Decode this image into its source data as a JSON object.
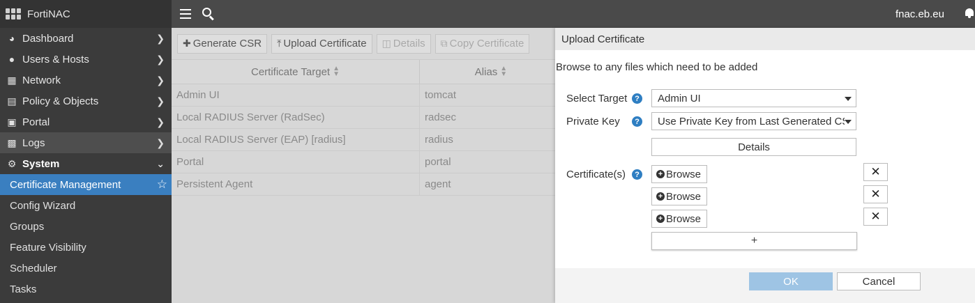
{
  "app": {
    "name": "FortiNAC",
    "host": "fnac.eb.eu"
  },
  "sidebar": {
    "items": [
      {
        "label": "Dashboard",
        "icon": "dashboard-icon"
      },
      {
        "label": "Users & Hosts",
        "icon": "user-icon"
      },
      {
        "label": "Network",
        "icon": "network-icon"
      },
      {
        "label": "Policy & Objects",
        "icon": "policy-icon"
      },
      {
        "label": "Portal",
        "icon": "portal-icon"
      },
      {
        "label": "Logs",
        "icon": "chart-icon"
      },
      {
        "label": "System",
        "icon": "gear-icon"
      }
    ],
    "subitems": [
      {
        "label": "Certificate Management",
        "active": true
      },
      {
        "label": "Config Wizard"
      },
      {
        "label": "Groups"
      },
      {
        "label": "Feature Visibility"
      },
      {
        "label": "Scheduler"
      },
      {
        "label": "Tasks"
      }
    ]
  },
  "toolbar": {
    "generate_csr": "Generate CSR",
    "upload_certificate": "Upload Certificate",
    "details": "Details",
    "copy_certificate": "Copy Certificate"
  },
  "table": {
    "columns": [
      "Certificate Target",
      "Alias"
    ],
    "rows": [
      [
        "Admin UI",
        "tomcat"
      ],
      [
        "Local RADIUS Server (RadSec)",
        "radsec"
      ],
      [
        "Local RADIUS Server (EAP) [radius]",
        "radius"
      ],
      [
        "Portal",
        "portal"
      ],
      [
        "Persistent Agent",
        "agent"
      ]
    ]
  },
  "dialog": {
    "title": "Upload Certificate",
    "message": "Browse to any files which need to be added",
    "select_target_label": "Select Target",
    "select_target_value": "Admin UI",
    "private_key_label": "Private Key",
    "private_key_value": "Use Private Key from Last Generated CSR",
    "details_label": "Details",
    "certificates_label": "Certificate(s)",
    "browse_label": "Browse",
    "add_symbol": "+",
    "remove_symbol": "✕",
    "ok_label": "OK",
    "cancel_label": "Cancel"
  },
  "colors": {
    "accent": "#3a7fc0",
    "sidebar": "#3b3b3b",
    "topbar": "#4a4a4a",
    "ok_button": "#9ec4e4"
  }
}
